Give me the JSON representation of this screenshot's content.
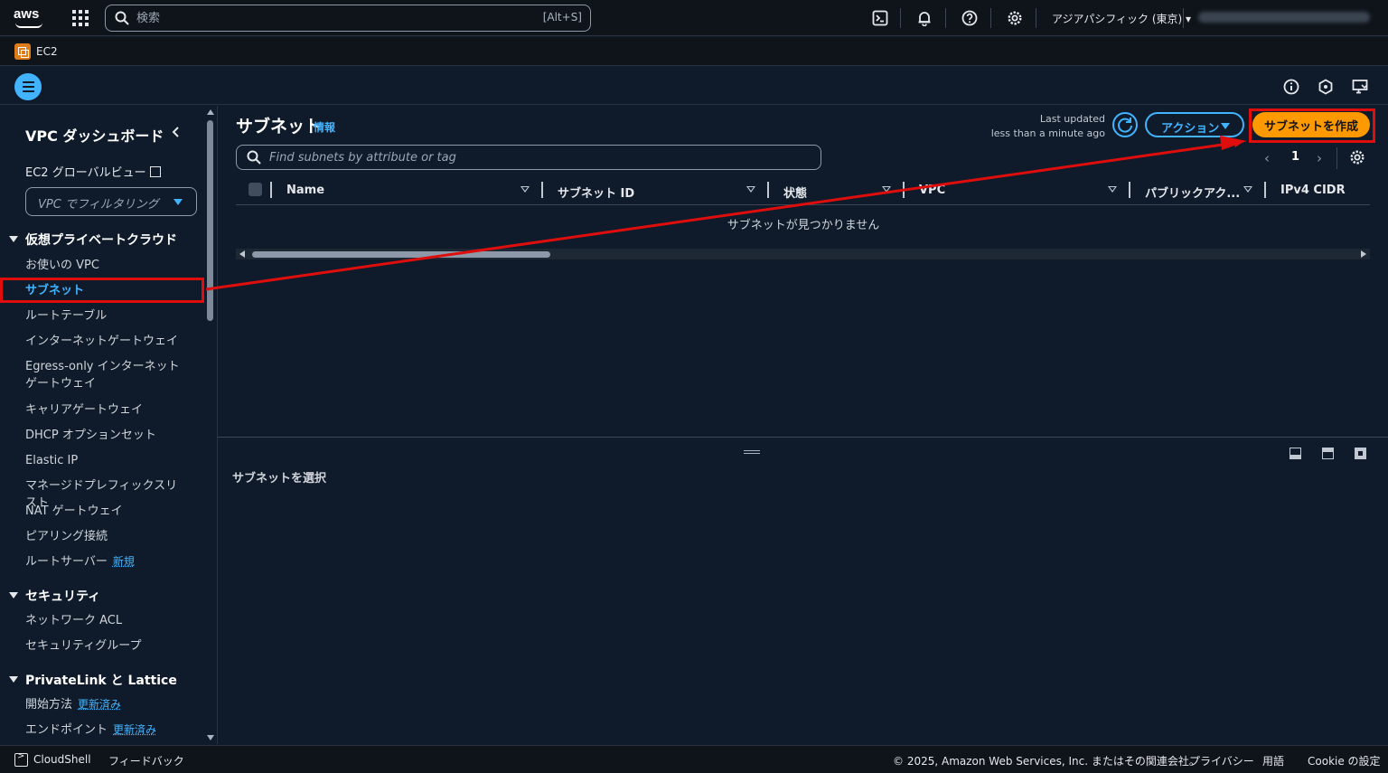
{
  "topbar": {
    "logo": "aws",
    "search_placeholder": "検索",
    "search_shortcut": "[Alt+S]",
    "icons": [
      "cloudshell-icon",
      "bell-icon",
      "help-icon",
      "gear-icon"
    ],
    "region": "アジアパシフィック (東京) ▾"
  },
  "service": {
    "name": "EC2"
  },
  "sidebar": {
    "title": "VPC ダッシュボード",
    "global_view": "EC2 グローバルビュー",
    "vpc_filter_placeholder": "VPC でフィルタリング",
    "sections": [
      {
        "title": "仮想プライベートクラウド",
        "items": [
          {
            "label": "お使いの VPC"
          },
          {
            "label": "サブネット",
            "active": true
          },
          {
            "label": "ルートテーブル"
          },
          {
            "label": "インターネットゲートウェイ"
          },
          {
            "label": "Egress-only インターネットゲートウェイ"
          },
          {
            "label": "キャリアゲートウェイ"
          },
          {
            "label": "DHCP オプションセット"
          },
          {
            "label": "Elastic IP"
          },
          {
            "label": "マネージドプレフィックスリスト"
          },
          {
            "label": "NAT ゲートウェイ"
          },
          {
            "label": "ピアリング接続"
          },
          {
            "label": "ルートサーバー",
            "badge": "新規"
          }
        ]
      },
      {
        "title": "セキュリティ",
        "items": [
          {
            "label": "ネットワーク ACL"
          },
          {
            "label": "セキュリティグループ"
          }
        ]
      },
      {
        "title": "PrivateLink と Lattice",
        "items": [
          {
            "label": "開始方法",
            "badge": "更新済み"
          },
          {
            "label": "エンドポイント",
            "badge": "更新済み"
          }
        ]
      }
    ]
  },
  "main": {
    "title": "サブネット",
    "info": "情報",
    "last_updated_line1": "Last updated",
    "last_updated_line2": "less than a minute ago",
    "actions_label": "アクション",
    "create_label": "サブネットを作成",
    "filter_placeholder": "Find subnets by attribute or tag",
    "page": "1",
    "columns": [
      "Name",
      "サブネット ID",
      "状態",
      "VPC",
      "パブリックアク...",
      "IPv4 CIDR"
    ],
    "empty_message": "サブネットが見つかりません"
  },
  "split_panel": {
    "title": "サブネットを選択"
  },
  "footer": {
    "cloudshell": "CloudShell",
    "feedback": "フィードバック",
    "copyright": "© 2025, Amazon Web Services, Inc. またはその関連会社。",
    "privacy": "プライバシー",
    "terms": "用語",
    "cookie": "Cookie の設定"
  },
  "colors": {
    "accent": "#42b4ff",
    "primary_button": "#ff9900",
    "annotation": "#e00d0d"
  }
}
